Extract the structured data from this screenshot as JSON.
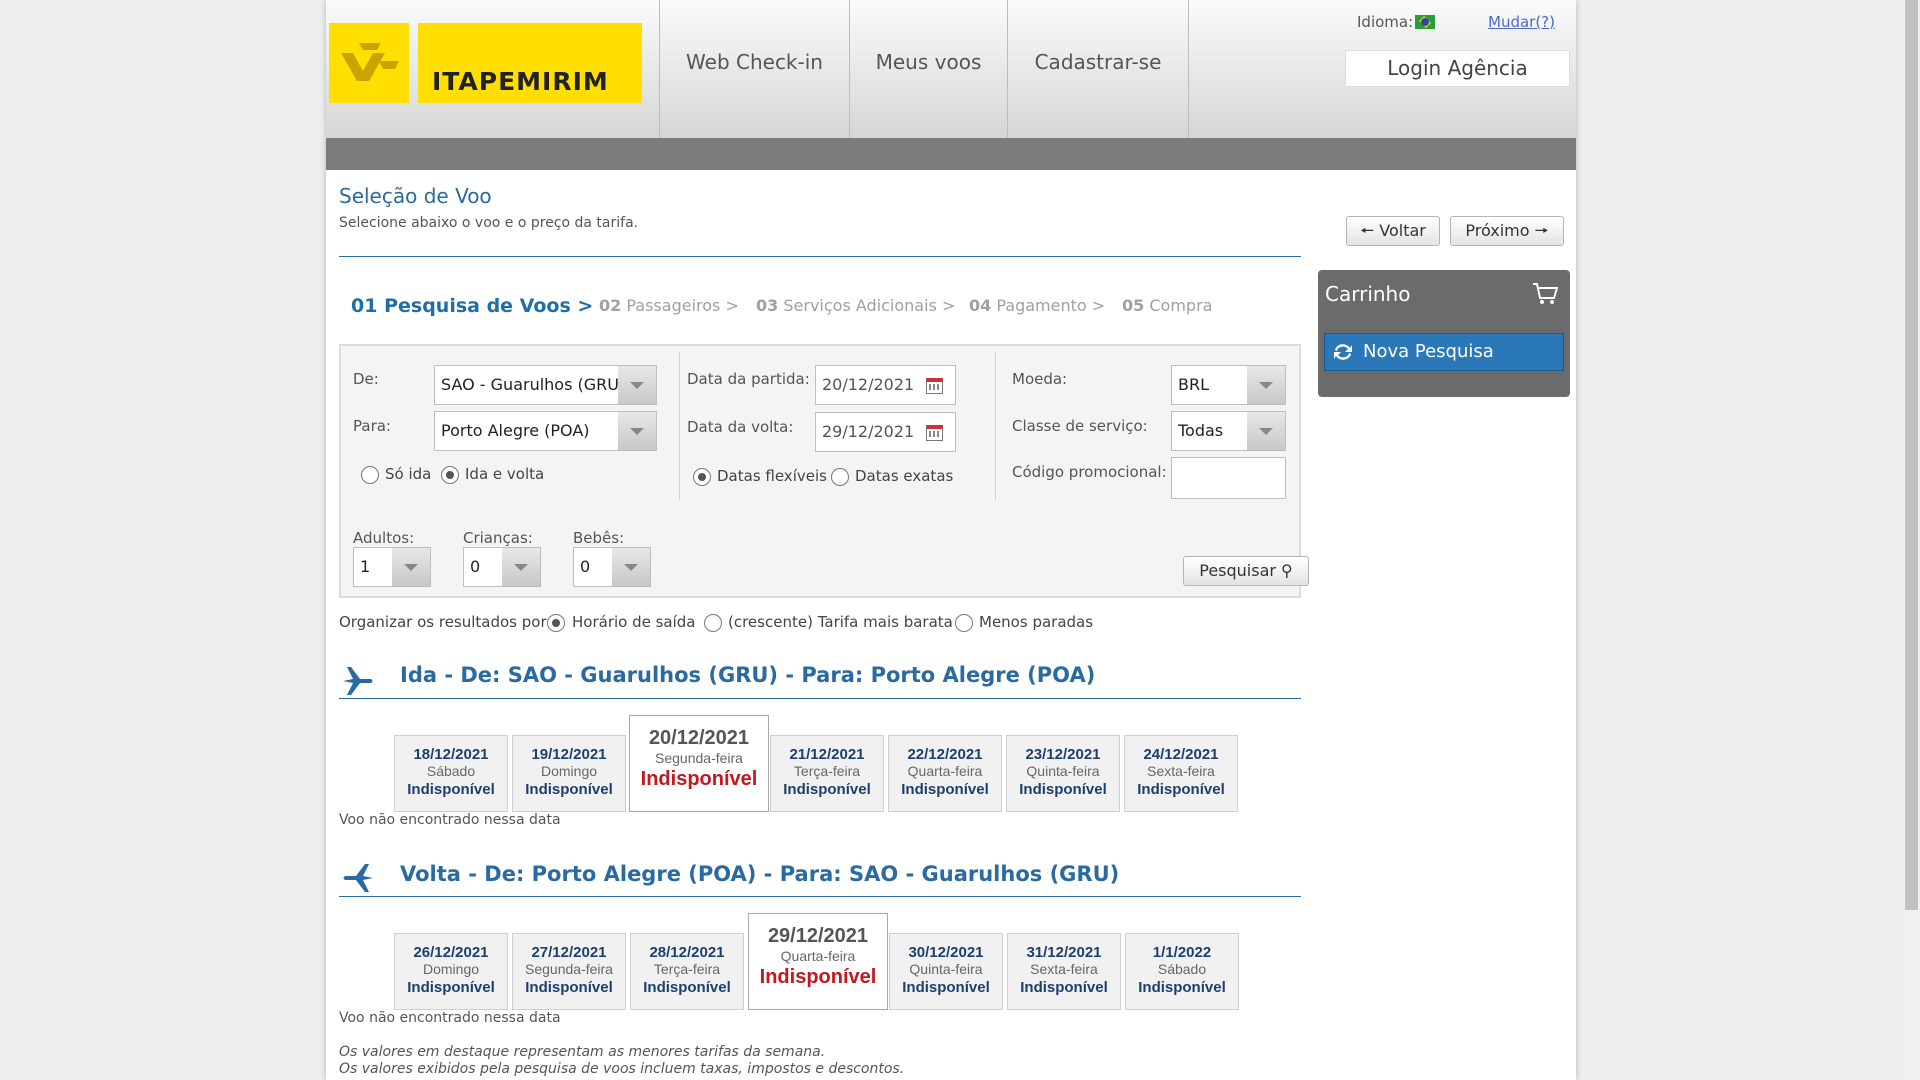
{
  "brand": {
    "name": "ITAPEMIRIM",
    "color": "#ffde00"
  },
  "nav": {
    "items": [
      "Web Check-in",
      "Meus voos",
      "Cadastrar-se"
    ]
  },
  "language": {
    "label": "Idioma:",
    "flag_icon": "brazil-flag-icon",
    "change_link": "Mudar(?)"
  },
  "login_button": "Login Agência",
  "page": {
    "title": "Seleção de Voo",
    "subtitle": "Selecione abaixo o voo e o preço da tarifa.",
    "back_button": "Voltar",
    "next_button": "Próximo"
  },
  "steps": [
    {
      "num": "01",
      "label": "Pesquisa de Voos >"
    },
    {
      "num": "02",
      "label": "Passageiros >"
    },
    {
      "num": "03",
      "label": "Serviços Adicionais >"
    },
    {
      "num": "04",
      "label": "Pagamento >"
    },
    {
      "num": "05",
      "label": "Compra"
    }
  ],
  "search": {
    "from_label": "De:",
    "from_value": "SAO - Guarulhos (GRU)",
    "to_label": "Para:",
    "to_value": "Porto Alegre (POA)",
    "trip_one_way": "Só ida",
    "trip_round": "Ida e volta",
    "trip_selected": "round",
    "depart_label": "Data da partida:",
    "depart_value": "20/12/2021",
    "return_label": "Data da volta:",
    "return_value": "29/12/2021",
    "flex_dates": "Datas flexíveis",
    "exact_dates": "Datas exatas",
    "dates_selected": "flex",
    "currency_label": "Moeda:",
    "currency_value": "BRL",
    "class_label": "Classe de serviço:",
    "class_value": "Todas",
    "promo_label": "Código promocional:",
    "promo_value": "",
    "adults_label": "Adultos:",
    "adults_value": "1",
    "children_label": "Crianças:",
    "children_value": "0",
    "infants_label": "Bebês:",
    "infants_value": "0",
    "search_button": "Pesquisar"
  },
  "cart": {
    "title": "Carrinho",
    "new_search_button": "Nova Pesquisa"
  },
  "sort": {
    "label": "Organizar os resultados por:",
    "options": [
      "Horário de saída",
      "(crescente) Tarifa mais barata",
      "Menos paradas"
    ],
    "selected": 0
  },
  "outbound": {
    "title": "Ida - De: SAO - Guarulhos (GRU) - Para: Porto Alegre (POA)",
    "days": [
      {
        "date": "18/12/2021",
        "weekday": "Sábado",
        "status": "Indisponível"
      },
      {
        "date": "19/12/2021",
        "weekday": "Domingo",
        "status": "Indisponível"
      },
      {
        "date": "20/12/2021",
        "weekday": "Segunda-feira",
        "status": "Indisponível",
        "selected": true
      },
      {
        "date": "21/12/2021",
        "weekday": "Terça-feira",
        "status": "Indisponível"
      },
      {
        "date": "22/12/2021",
        "weekday": "Quarta-feira",
        "status": "Indisponível"
      },
      {
        "date": "23/12/2021",
        "weekday": "Quinta-feira",
        "status": "Indisponível"
      },
      {
        "date": "24/12/2021",
        "weekday": "Sexta-feira",
        "status": "Indisponível"
      }
    ],
    "note": "Voo não encontrado nessa data"
  },
  "inbound": {
    "title": "Volta - De: Porto Alegre (POA) - Para: SAO - Guarulhos (GRU)",
    "days": [
      {
        "date": "26/12/2021",
        "weekday": "Domingo",
        "status": "Indisponível"
      },
      {
        "date": "27/12/2021",
        "weekday": "Segunda-feira",
        "status": "Indisponível"
      },
      {
        "date": "28/12/2021",
        "weekday": "Terça-feira",
        "status": "Indisponível"
      },
      {
        "date": "29/12/2021",
        "weekday": "Quarta-feira",
        "status": "Indisponível",
        "selected": true
      },
      {
        "date": "30/12/2021",
        "weekday": "Quinta-feira",
        "status": "Indisponível"
      },
      {
        "date": "31/12/2021",
        "weekday": "Sexta-feira",
        "status": "Indisponível"
      },
      {
        "date": "1/1/2022",
        "weekday": "Sábado",
        "status": "Indisponível"
      }
    ],
    "note": "Voo não encontrado nessa data"
  },
  "footnotes": [
    "Os valores em destaque representam as menores tarifas da semana.",
    "Os valores exibidos pela pesquisa de voos incluem taxas, impostos e descontos."
  ]
}
